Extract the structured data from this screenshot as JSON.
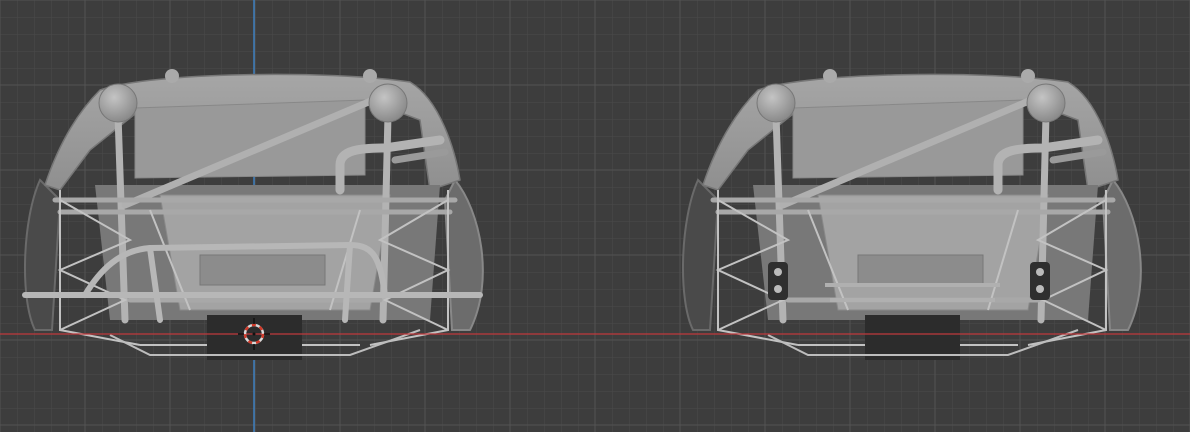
{
  "colors": {
    "background": "#3d3d3d",
    "grid_minor": "#4a4a4a",
    "grid_major": "#535353",
    "axis_x": "#c0393c",
    "axis_z": "#3d7fc0",
    "model_light": "#9b9b9b",
    "model_mid": "#7f7f7f",
    "model_dark": "#2c2c2c",
    "cursor_ring": "#d9d9d9",
    "cursor_dash": "#d03a2a"
  },
  "icons": {
    "cursor": "3d-cursor-icon"
  },
  "models": [
    {
      "name": "buggy-frame-with-bumper"
    },
    {
      "name": "buggy-frame-without-bumper"
    }
  ]
}
